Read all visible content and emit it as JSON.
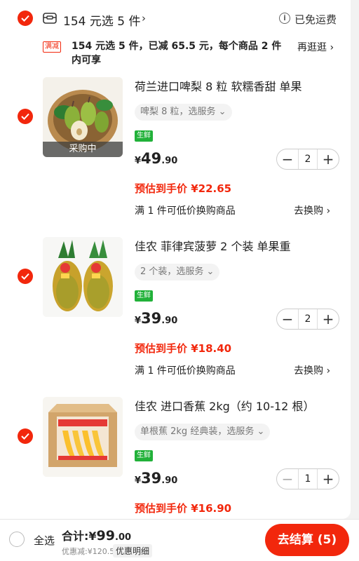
{
  "shop": {
    "title": "154 元选 5 件",
    "chevron": "›",
    "free_shipping": "已免运费",
    "info_icon": "ⓘ"
  },
  "promo": {
    "tag": "满减",
    "text": "154 元选 5 件，已减 65.5 元，每个商品 2 件内可享",
    "link": "再逛逛 ›"
  },
  "items": [
    {
      "title": "荷兰进口啤梨 8 粒 软糯香甜 单果",
      "spec": "啤梨 8 粒，选服务 ⌄",
      "fresh_tag": "生鲜",
      "badge": "采购中",
      "price_symbol": "¥",
      "price_int": "49",
      "price_dec": ".90",
      "qty": "2",
      "estimate": "预估到手价 ¥22.65",
      "trade": "满 1 件可低价换购商品",
      "trade_link": "去换购 ›"
    },
    {
      "title": "佳农 菲律宾菠萝 2 个装 单果重",
      "spec": "2 个装，选服务 ⌄",
      "fresh_tag": "生鲜",
      "price_symbol": "¥",
      "price_int": "39",
      "price_dec": ".90",
      "qty": "2",
      "estimate": "预估到手价 ¥18.40",
      "trade": "满 1 件可低价换购商品",
      "trade_link": "去换购 ›"
    },
    {
      "title": "佳农 进口香蕉 2kg（约 10-12 根）",
      "spec": "单根蕉 2kg 经典装，选服务 ⌄",
      "fresh_tag": "生鲜",
      "price_symbol": "¥",
      "price_int": "39",
      "price_dec": ".90",
      "qty": "1",
      "estimate": "预估到手价 ¥16.90"
    }
  ],
  "stepper": {
    "minus": "−",
    "plus": "+"
  },
  "bottom": {
    "select_all": "全选",
    "total_label": "合计:",
    "total_symbol": "¥",
    "total_int": "99",
    "total_dec": ".00",
    "discount": "优惠减:¥120.50",
    "detail": "优惠明细",
    "checkout": "去结算 (5)"
  },
  "colors": {
    "accent": "#f2270c",
    "fresh": "#21b139"
  }
}
